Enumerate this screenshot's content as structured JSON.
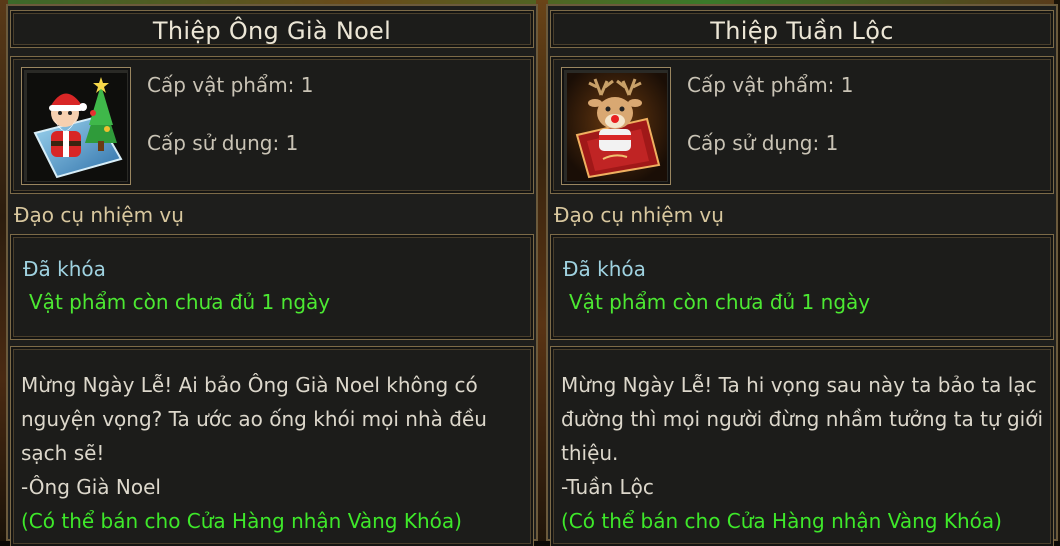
{
  "cards": [
    {
      "title": "Thiệp Ông Già Noel",
      "icon": "santa-card-icon",
      "item_level": "Cấp vật phẩm: 1",
      "use_level": "Cấp sử dụng: 1",
      "category": "Đạo cụ nhiệm vụ",
      "locked": "Đã khóa",
      "expiry": "Vật phẩm còn chưa đủ 1 ngày",
      "description": [
        "Mừng Ngày Lễ! Ai bảo Ông Già Noel không có",
        " nguyện vọng? Ta ước ao ống khói mọi nhà đều",
        " sạch sẽ!",
        "-Ông Già Noel"
      ],
      "sell_note": "(Có thể bán cho Cửa Hàng nhận Vàng Khóa)"
    },
    {
      "title": "Thiệp Tuần Lộc",
      "icon": "reindeer-card-icon",
      "item_level": "Cấp vật phẩm: 1",
      "use_level": "Cấp sử dụng: 1",
      "category": "Đạo cụ nhiệm vụ",
      "locked": "Đã khóa",
      "expiry": "Vật phẩm còn chưa đủ 1 ngày",
      "description": [
        "Mừng Ngày Lễ! Ta hi vọng sau này ta bảo ta lạc",
        " đường thì mọi người đừng nhầm tưởng ta tự giới",
        " thiệu.",
        "-Tuần Lộc"
      ],
      "sell_note": "(Có thể bán cho Cửa Hàng nhận Vàng Khóa)"
    }
  ],
  "colors": {
    "title_text": "#ece6d6",
    "locked_text": "#9fd2e0",
    "expiry_text": "#4ce832",
    "sell_text": "#3ee82a",
    "border": "#7d6b48"
  }
}
